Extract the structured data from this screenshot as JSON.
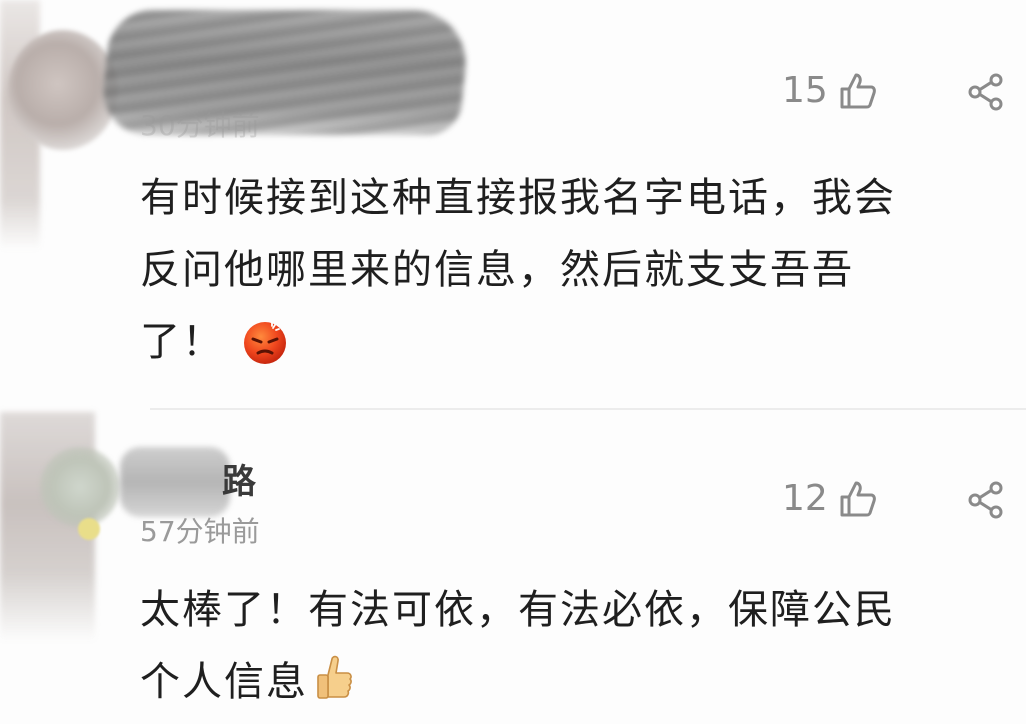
{
  "comments": [
    {
      "time": "30分钟前",
      "likes": "15",
      "lines": [
        "有时候接到这种直接报我名字电话，我会",
        "反问他哪里来的信息，然后就支支吾吾",
        "了！"
      ],
      "emoji": "angry-face-icon"
    },
    {
      "username_visible": "路",
      "time": "57分钟前",
      "likes": "12",
      "lines": [
        "太棒了！有法可依，有法必依，保障公民",
        "个人信息"
      ],
      "emoji": "thumbs-up-icon"
    }
  ],
  "colors": {
    "like_count": "#8a8a8a",
    "time": "#9a9a9a",
    "text": "#1f1f1f",
    "divider": "#ececec",
    "angry_emoji": "#f0471e"
  },
  "icons": {
    "like": "thumb-up-outline-icon",
    "share": "share-icon"
  }
}
